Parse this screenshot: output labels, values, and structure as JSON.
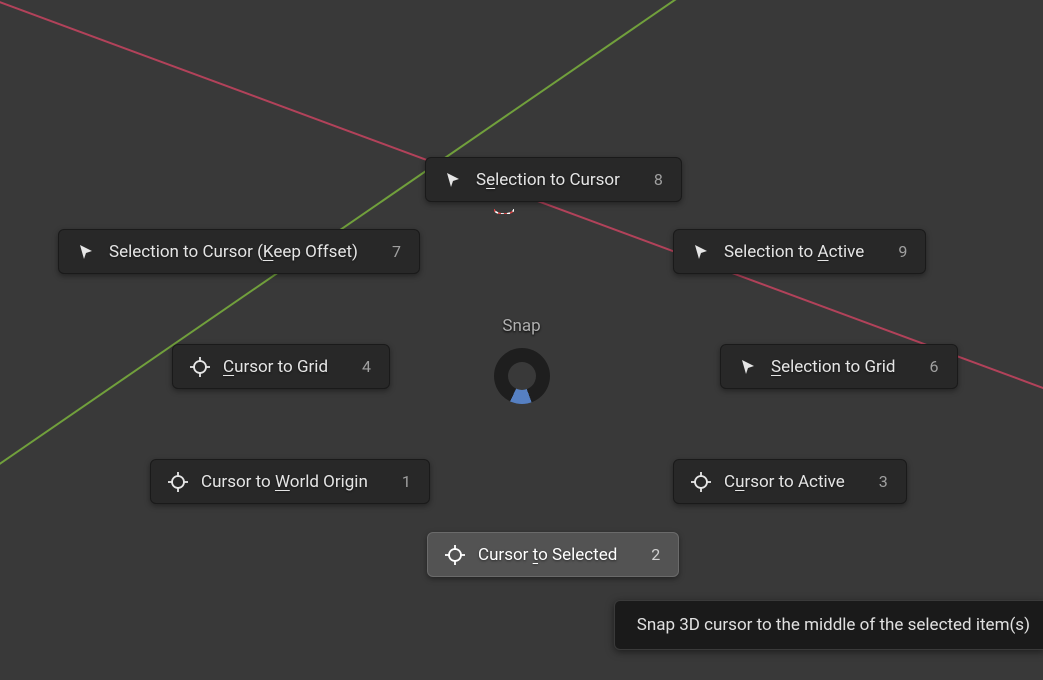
{
  "menu_title": "Snap",
  "items": {
    "sel_cursor": {
      "pre": "S",
      "ul": "e",
      "post": "lection to Cursor",
      "key": "8",
      "icon": "pointer"
    },
    "sel_cursor_ko": {
      "pre": "Selection to Cursor (",
      "ul": "K",
      "post": "eep Offset)",
      "key": "7",
      "icon": "pointer"
    },
    "sel_active": {
      "pre": "Selection to ",
      "ul": "A",
      "post": "ctive",
      "key": "9",
      "icon": "pointer"
    },
    "cur_grid": {
      "pre": "",
      "ul": "C",
      "post": "ursor to Grid",
      "key": "4",
      "icon": "cursor"
    },
    "sel_grid": {
      "pre": "",
      "ul": "S",
      "post": "election to Grid",
      "key": "6",
      "icon": "pointer"
    },
    "cur_worldorigin": {
      "pre": "Cursor to ",
      "ul": "W",
      "post": "orld Origin",
      "key": "1",
      "icon": "cursor"
    },
    "cur_active": {
      "pre": "C",
      "ul": "u",
      "post": "rsor to Active",
      "key": "3",
      "icon": "cursor"
    },
    "cur_selected": {
      "pre": "Cursor ",
      "ul": "t",
      "post": "o Selected",
      "key": "2",
      "icon": "cursor"
    }
  },
  "tooltip_text": "Snap 3D cursor to the middle of the selected item(s)"
}
